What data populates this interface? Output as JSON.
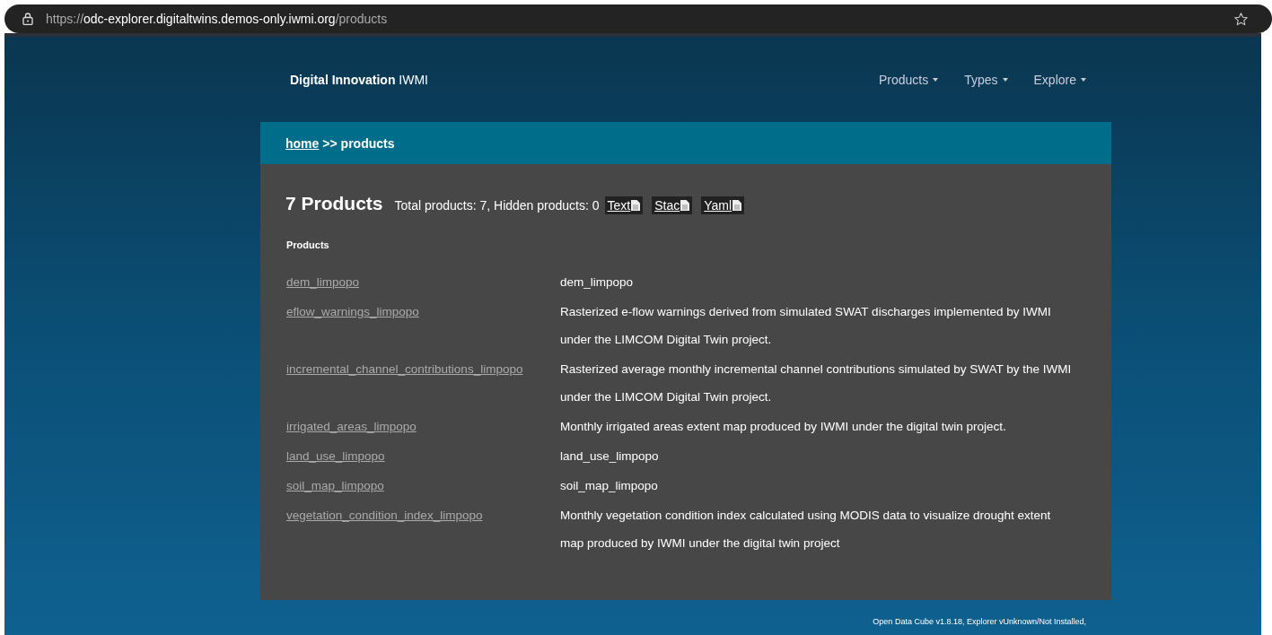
{
  "browser": {
    "url": {
      "scheme": "https://",
      "host": "odc-explorer.digitaltwins.demos-only.iwmi.org",
      "path": "/products"
    }
  },
  "navbar": {
    "brand_bold": "Digital Innovation",
    "brand": "IWMI",
    "menus": [
      {
        "label": "Products"
      },
      {
        "label": "Types"
      },
      {
        "label": "Explore"
      }
    ]
  },
  "breadcrumb": {
    "home": "home",
    "separator": ">>",
    "current": "products"
  },
  "heading": {
    "title": "7 Products",
    "summary": "Total products: 7, Hidden products: 0",
    "formats": [
      {
        "label": "Text"
      },
      {
        "label": "Stac"
      },
      {
        "label": "Yaml"
      }
    ]
  },
  "table": {
    "column_heading": "Products",
    "rows": [
      {
        "name": "dem_limpopo",
        "description": "dem_limpopo"
      },
      {
        "name": "eflow_warnings_limpopo",
        "description": "Rasterized e-flow warnings derived from simulated SWAT discharges implemented by IWMI under the LIMCOM Digital Twin project."
      },
      {
        "name": "incremental_channel_contributions_limpopo",
        "description": "Rasterized average monthly incremental channel contributions simulated by SWAT by the IWMI under the LIMCOM Digital Twin project."
      },
      {
        "name": "irrigated_areas_limpopo",
        "description": "Monthly irrigated areas extent map produced by IWMI under the digital twin project."
      },
      {
        "name": "land_use_limpopo",
        "description": "land_use_limpopo"
      },
      {
        "name": "soil_map_limpopo",
        "description": "soil_map_limpopo"
      },
      {
        "name": "vegetation_condition_index_limpopo",
        "description": "Monthly vegetation condition index calculated using MODIS data to visualize drought extent map produced by IWMI under the digital twin project"
      }
    ]
  },
  "footer": "Open Data Cube v1.8.18, Explorer vUnknown/Not Installed,"
}
